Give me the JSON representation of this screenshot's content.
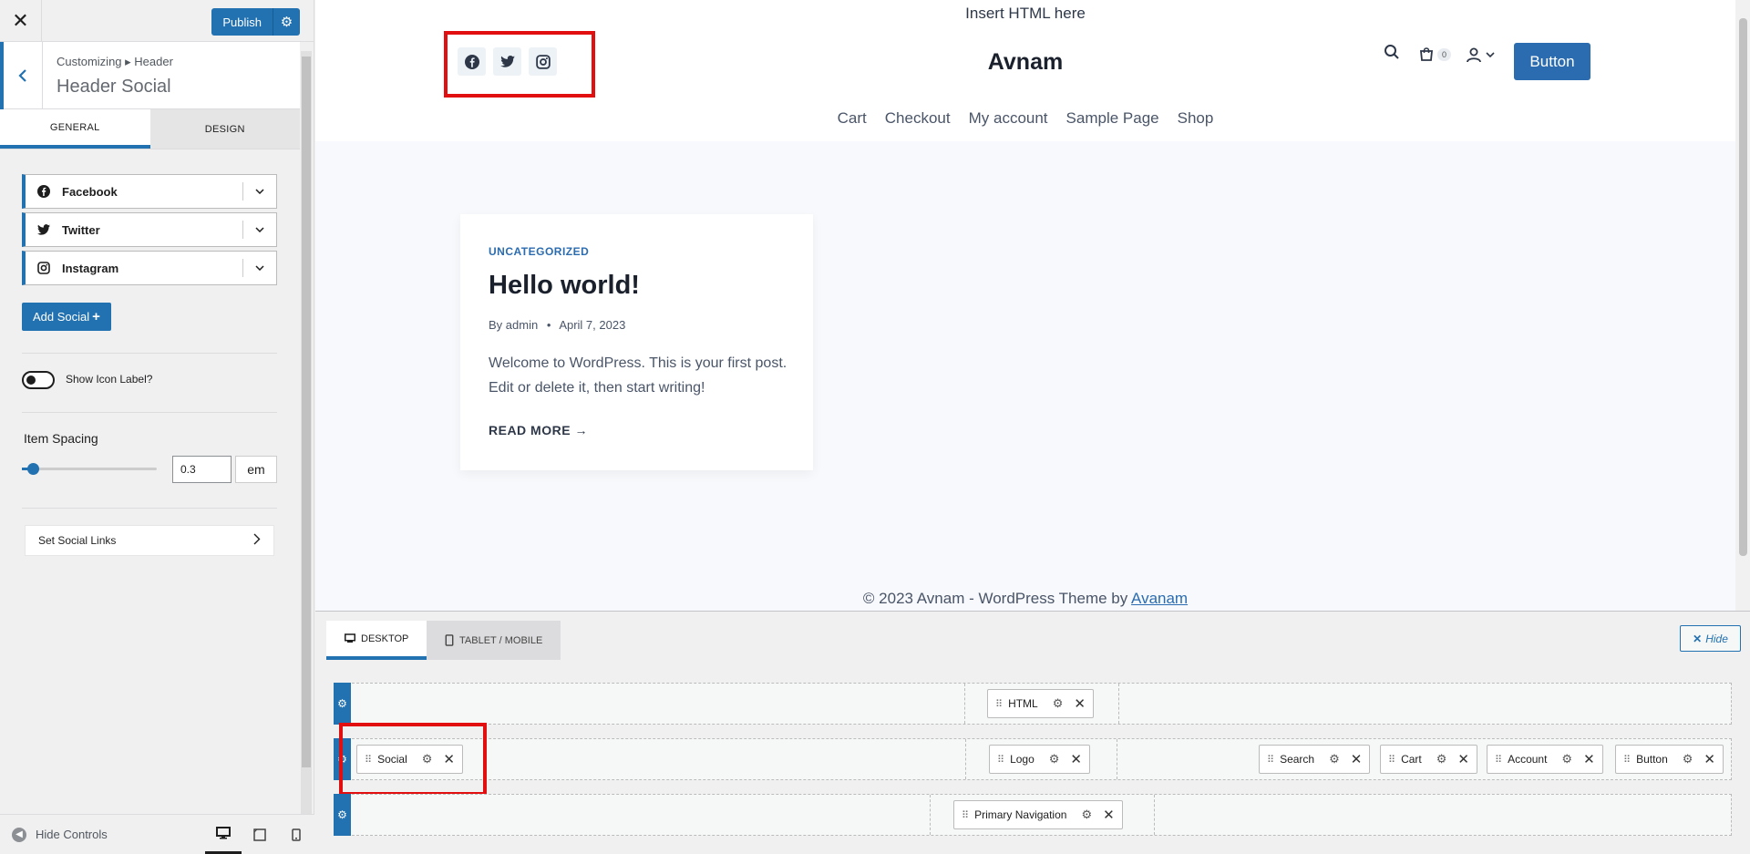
{
  "sidebar": {
    "close_icon": "close-icon",
    "publish_label": "Publish",
    "breadcrumb": "Customizing ▸ Header",
    "section_title": "Header Social",
    "tabs": [
      {
        "label": "GENERAL"
      },
      {
        "label": "DESIGN"
      }
    ],
    "social_items": [
      {
        "label": "Facebook",
        "icon": "facebook-icon"
      },
      {
        "label": "Twitter",
        "icon": "twitter-icon"
      },
      {
        "label": "Instagram",
        "icon": "instagram-icon"
      }
    ],
    "add_social_label": "Add Social",
    "show_icon_label": "Show Icon Label?",
    "show_icon_label_on": false,
    "item_spacing_label": "Item Spacing",
    "item_spacing_value": "0.3",
    "item_spacing_unit": "em",
    "item_spacing_fraction": 0.08,
    "set_social_links": "Set Social Links",
    "hide_controls": "Hide Controls"
  },
  "preview": {
    "insert_html": "Insert HTML here",
    "site_title": "Avnam",
    "nav": [
      "Cart",
      "Checkout",
      "My account",
      "Sample Page",
      "Shop"
    ],
    "cart_count": "0",
    "header_button": "Button",
    "post": {
      "category": "UNCATEGORIZED",
      "title": "Hello world!",
      "by": "By",
      "author": "admin",
      "date": "April 7, 2023",
      "excerpt": "Welcome to WordPress. This is your first post. Edit or delete it, then start writing!",
      "read_more": "READ MORE →"
    },
    "footer_prefix": "© 2023 Avnam - WordPress Theme by",
    "footer_link": "Avanam"
  },
  "builder": {
    "tabs": [
      {
        "label": "DESKTOP"
      },
      {
        "label": "TABLET / MOBILE"
      }
    ],
    "hide_label": "Hide",
    "rows": {
      "top": {
        "center": "HTML"
      },
      "main": {
        "left": "Social",
        "center": "Logo",
        "right": [
          "Search",
          "Cart",
          "Account",
          "Button"
        ]
      },
      "bottom": {
        "center": "Primary Navigation"
      }
    }
  },
  "colors": {
    "accent": "#2271b1",
    "highlight": "#e10f0f",
    "header_button": "#2b6cb0"
  }
}
